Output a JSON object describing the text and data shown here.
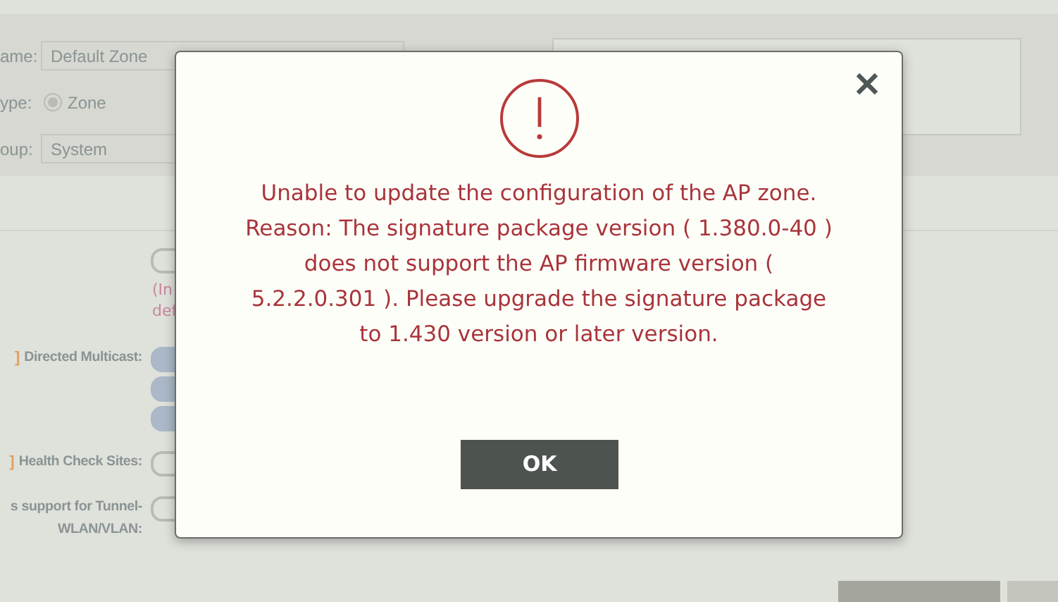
{
  "form": {
    "fields": [
      {
        "label": "ame:",
        "value": "Default Zone",
        "kind": "text"
      },
      {
        "label": "ype:",
        "value": "Zone",
        "kind": "radio",
        "selected": true
      },
      {
        "label": "oup:",
        "value": "System",
        "kind": "text"
      }
    ],
    "note_lines": [
      "(In",
      "def"
    ],
    "settings": [
      {
        "label": "Directed Multicast:",
        "marker": "]",
        "toggles": [
          {
            "on": true
          },
          {
            "on": true
          },
          {
            "on": true
          }
        ]
      },
      {
        "label": "Health Check Sites:",
        "marker": "]",
        "toggles": [
          {
            "on": false
          }
        ]
      },
      {
        "label": "s support for Tunnel-\nWLAN/VLAN:",
        "toggles": [
          {
            "on": false
          }
        ]
      }
    ],
    "top_toggle": {
      "on": false
    }
  },
  "dialog": {
    "message": [
      "Unable to update the configuration of the AP zone.",
      "Reason: The signature package version ( 1.380.0-40 )",
      "does not support the AP firmware version (",
      "5.2.2.0.301 ). Please upgrade the signature package",
      "to 1.430 version or later version."
    ],
    "ok_button": "OK"
  }
}
